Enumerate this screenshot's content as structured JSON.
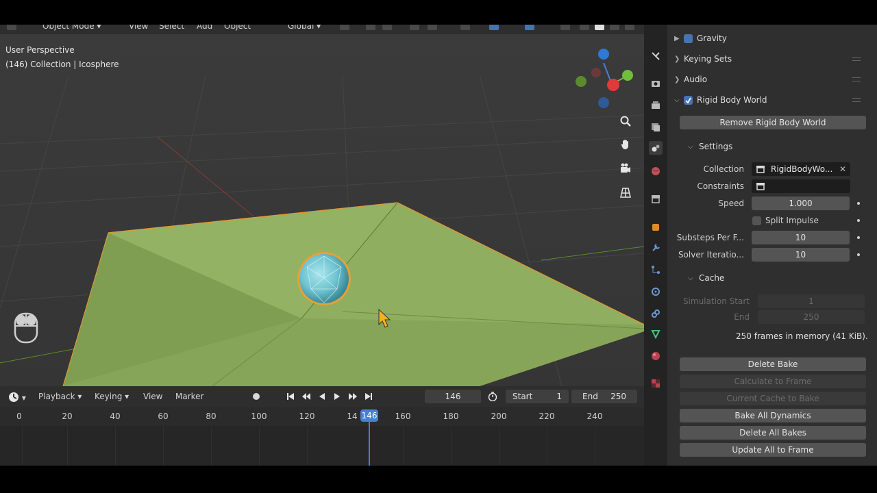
{
  "header": {
    "mode": "Object Mode",
    "menus": [
      "View",
      "Select",
      "Add",
      "Object"
    ],
    "orientation": "Global"
  },
  "viewport": {
    "perspective": "User Perspective",
    "collection_info": "(146) Collection | Icosphere"
  },
  "properties": {
    "gravity": "Gravity",
    "keying_sets": "Keying Sets",
    "audio": "Audio",
    "rigid_body_world": "Rigid Body World",
    "remove_btn": "Remove Rigid Body World",
    "settings": {
      "title": "Settings",
      "collection_label": "Collection",
      "collection_value": "RigidBodyWo...",
      "constraints_label": "Constraints",
      "speed_label": "Speed",
      "speed_value": "1.000",
      "split_impulse": "Split Impulse",
      "substeps_label": "Substeps Per F...",
      "substeps_value": "10",
      "solver_label": "Solver Iteratio...",
      "solver_value": "10"
    },
    "cache": {
      "title": "Cache",
      "sim_start_label": "Simulation Start",
      "sim_start_value": "1",
      "end_label": "End",
      "end_value": "250",
      "memory": "250 frames in memory (41 KiB)."
    },
    "buttons": {
      "delete_bake": "Delete Bake",
      "calculate": "Calculate to Frame",
      "current_cache": "Current Cache to Bake",
      "bake_all": "Bake All Dynamics",
      "delete_all": "Delete All Bakes",
      "update_all": "Update All to Frame"
    }
  },
  "timeline": {
    "playback": "Playback",
    "keying": "Keying",
    "view": "View",
    "marker": "Marker",
    "current_frame": "146",
    "start_label": "Start",
    "start_value": "1",
    "end_label": "End",
    "end_value": "250",
    "ticks": [
      "0",
      "20",
      "40",
      "60",
      "80",
      "100",
      "120",
      "14",
      "160",
      "180",
      "200",
      "220",
      "240"
    ],
    "playhead": "146",
    "playhead_frame": 146
  },
  "colors": {
    "accent": "#4772b3",
    "playhead": "#4a7fd4",
    "plane": "#8fae5f",
    "sphere": "#6fc3d0",
    "selection": "#f0a030"
  }
}
